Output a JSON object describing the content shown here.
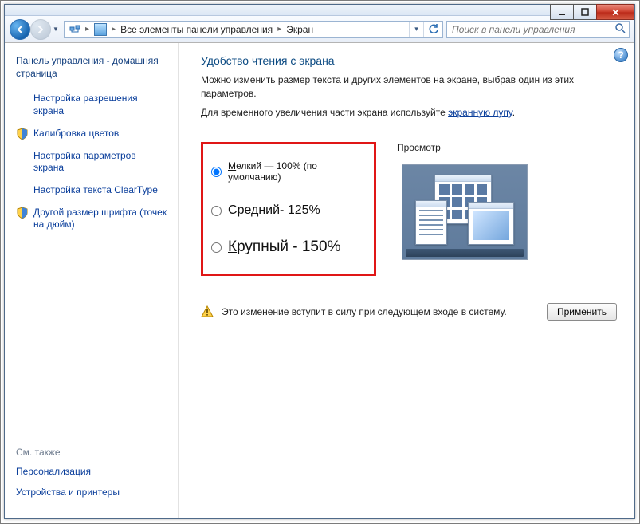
{
  "window": {
    "minimize": "_",
    "maximize": "❐",
    "close": "✕"
  },
  "nav": {
    "path_root": "Все элементы панели управления",
    "path_leaf": "Экран",
    "search_placeholder": "Поиск в панели управления"
  },
  "sidebar": {
    "home": "Панель управления - домашняя страница",
    "tasks": [
      {
        "label": "Настройка разрешения экрана",
        "shield": false
      },
      {
        "label": "Калибровка цветов",
        "shield": true
      },
      {
        "label": "Настройка параметров экрана",
        "shield": false
      },
      {
        "label": "Настройка текста ClearType",
        "shield": false
      },
      {
        "label": "Другой размер шрифта (точек на дюйм)",
        "shield": true
      }
    ],
    "see_also_header": "См. также",
    "see_also": [
      "Персонализация",
      "Устройства и принтеры"
    ]
  },
  "content": {
    "title": "Удобство чтения с экрана",
    "lead_1": "Можно изменить размер текста и других элементов на экране, выбрав один из этих параметров.",
    "lead_2_a": "Для временного увеличения части экрана используйте ",
    "lead_2_link": "экранную лупу",
    "lead_2_b": ".",
    "options": {
      "small": {
        "u": "М",
        "rest": "елкий — 100% (по умолчанию)"
      },
      "medium": {
        "u": "С",
        "rest": "редний- 125%"
      },
      "large": {
        "u": "К",
        "rest": "рупный - 150%"
      }
    },
    "selected": "small",
    "preview_header": "Просмотр",
    "notice": "Это изменение вступит в силу при следующем входе в систему.",
    "apply": "Применить"
  }
}
